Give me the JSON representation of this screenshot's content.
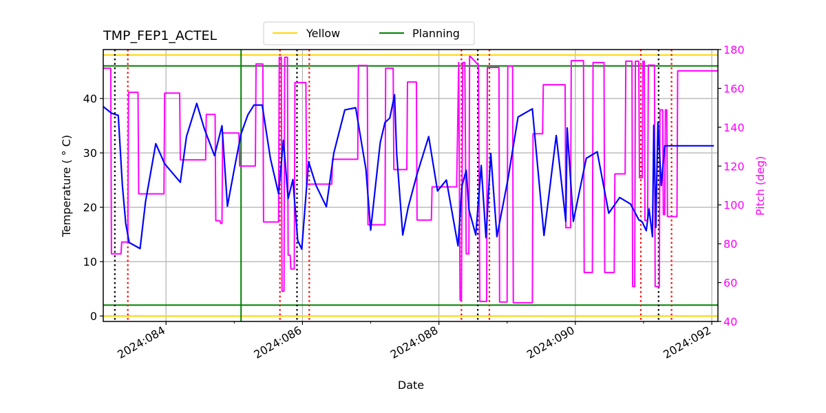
{
  "chart_data": {
    "type": "line",
    "title": "TMP_FEP1_ACTEL",
    "xlabel": "Date",
    "ylabel": "Temperature ($^\\circ$C)",
    "ylabel_display": "Temperature ( ° C)",
    "y2label": "Pitch (deg)",
    "xlim": [
      83.08,
      92.09
    ],
    "ylim": [
      -1,
      49
    ],
    "y2lim": [
      40,
      180
    ],
    "x_ticks": [
      84,
      86,
      88,
      90,
      92
    ],
    "x_tick_labels": [
      "2024:084",
      "2024:086",
      "2024:088",
      "2024:090",
      "2024:092"
    ],
    "x_minor_ticks": [
      85,
      87,
      89,
      91
    ],
    "y_ticks": [
      0,
      10,
      20,
      30,
      40
    ],
    "y_tick_labels": [
      "0",
      "10",
      "20",
      "30",
      "40"
    ],
    "y2_ticks": [
      40,
      60,
      80,
      100,
      120,
      140,
      160,
      180
    ],
    "y2_tick_labels": [
      "40",
      "60",
      "80",
      "100",
      "120",
      "140",
      "160",
      "180"
    ],
    "grid": true,
    "legend": {
      "placement": "top-center-outside",
      "entries": [
        {
          "label": "Yellow",
          "color": "#ffd700"
        },
        {
          "label": "Planning",
          "color": "#008000"
        }
      ]
    },
    "colors": {
      "temperature": "#0000ff",
      "pitch": "#ff00ff",
      "yellow": "#ffd700",
      "planning": "#008000",
      "grid": "#b0b0b0",
      "pitch_axis": "#ff00ff",
      "red_marker": "#ff0000",
      "black_marker": "#000000"
    },
    "limits": {
      "yellow": [
        0,
        48
      ],
      "planning": [
        2,
        46
      ]
    },
    "vertical_markers": {
      "planning": [
        85.1
      ],
      "red_dotted": [
        83.44,
        85.67,
        86.1,
        88.33,
        88.74,
        90.96,
        91.41
      ],
      "black_dotted": [
        83.25,
        85.92,
        88.57,
        91.22
      ]
    },
    "series": [
      {
        "name": "Temperature",
        "axis": "left",
        "x": [
          83.08,
          83.2,
          83.3,
          83.36,
          83.41,
          83.46,
          83.62,
          83.7,
          83.85,
          83.98,
          84.21,
          84.3,
          84.45,
          84.56,
          84.71,
          84.82,
          84.9,
          85.0,
          85.1,
          85.2,
          85.29,
          85.41,
          85.53,
          85.65,
          85.72,
          85.79,
          85.86,
          85.93,
          85.99,
          86.09,
          86.2,
          86.35,
          86.46,
          86.62,
          86.78,
          86.93,
          87.0,
          87.08,
          87.14,
          87.21,
          87.28,
          87.35,
          87.38,
          87.47,
          87.55,
          87.68,
          87.85,
          87.98,
          88.11,
          88.28,
          88.34,
          88.4,
          88.44,
          88.54,
          88.62,
          88.69,
          88.76,
          88.85,
          89.01,
          89.16,
          89.37,
          89.54,
          89.72,
          89.86,
          89.88,
          89.97,
          90.16,
          90.32,
          90.49,
          90.65,
          90.81,
          90.93,
          90.98,
          91.04,
          91.08,
          91.13,
          91.15,
          91.18,
          91.21,
          91.26,
          91.31,
          91.47,
          91.62,
          91.78,
          91.91,
          92.03
        ],
        "y": [
          38.5,
          37.3,
          36.9,
          24.0,
          17.0,
          13.5,
          12.4,
          21.0,
          31.7,
          28.0,
          24.6,
          33.0,
          39.1,
          34.5,
          29.5,
          35.0,
          20.2,
          27.0,
          33.5,
          37.0,
          38.8,
          38.8,
          29.0,
          22.5,
          32.3,
          21.6,
          25.1,
          13.9,
          12.3,
          28.4,
          24.0,
          20.1,
          30.0,
          37.9,
          38.3,
          27.0,
          15.8,
          25.0,
          31.9,
          35.6,
          36.4,
          40.7,
          30.0,
          14.9,
          20.0,
          26.1,
          33.0,
          23.0,
          25.0,
          12.9,
          24.0,
          26.8,
          19.6,
          14.9,
          27.7,
          14.4,
          29.9,
          14.6,
          25.0,
          36.6,
          38.1,
          14.8,
          33.2,
          17.4,
          34.6,
          17.4,
          29.0,
          30.2,
          18.9,
          21.8,
          20.6,
          17.7,
          17.3,
          15.7,
          19.7,
          14.6,
          35.1,
          16.3,
          35.6,
          24.0,
          31.3,
          31.3,
          31.3,
          31.3,
          31.3,
          31.3
        ]
      },
      {
        "name": "Pitch",
        "axis": "right",
        "x": [
          83.08,
          83.19,
          83.2,
          83.34,
          83.35,
          83.44,
          83.45,
          83.59,
          83.6,
          83.97,
          83.98,
          84.2,
          84.21,
          84.58,
          84.59,
          84.72,
          84.73,
          84.79,
          84.8,
          84.82,
          84.83,
          85.07,
          85.08,
          85.31,
          85.32,
          85.42,
          85.43,
          85.65,
          85.66,
          85.69,
          85.7,
          85.73,
          85.74,
          85.78,
          85.79,
          85.82,
          85.83,
          85.88,
          85.89,
          85.95,
          85.96,
          85.97,
          86.05,
          86.06,
          86.43,
          86.44,
          86.81,
          86.82,
          86.95,
          86.96,
          87.21,
          87.22,
          87.33,
          87.34,
          87.53,
          87.54,
          87.67,
          87.68,
          87.89,
          87.9,
          88.26,
          88.29,
          88.31,
          88.33,
          88.35,
          88.38,
          88.4,
          88.44,
          88.45,
          88.46,
          88.58,
          88.6,
          88.67,
          88.7,
          88.71,
          88.72,
          88.88,
          88.89,
          89.0,
          89.01,
          89.08,
          89.09,
          89.16,
          89.17,
          89.37,
          89.38,
          89.52,
          89.53,
          89.85,
          89.86,
          89.93,
          89.94,
          90.12,
          90.13,
          90.25,
          90.26,
          90.42,
          90.43,
          90.57,
          90.58,
          90.73,
          90.74,
          90.83,
          90.84,
          90.87,
          90.88,
          90.93,
          90.94,
          90.98,
          90.99,
          91.01,
          91.02,
          91.06,
          91.07,
          91.16,
          91.17,
          91.23,
          91.24,
          91.28,
          91.29,
          91.31,
          91.32,
          91.34,
          91.35,
          91.49,
          91.5,
          91.7,
          91.71,
          91.85,
          91.86,
          91.97,
          91.98,
          92.09
        ],
        "y": [
          170.4,
          170.4,
          74.8,
          74.8,
          80.9,
          80.9,
          158.0,
          158.0,
          105.7,
          105.7,
          157.6,
          157.6,
          123.2,
          123.2,
          146.6,
          146.6,
          91.9,
          91.9,
          90.5,
          90.5,
          137.0,
          137.0,
          120.0,
          120.0,
          172.6,
          172.6,
          91.2,
          91.2,
          176.0,
          176.0,
          55.6,
          55.6,
          176.0,
          176.0,
          74.1,
          74.1,
          67.0,
          67.0,
          163.0,
          163.0,
          163.0,
          163.0,
          163.0,
          110.7,
          110.7,
          123.5,
          123.5,
          171.8,
          171.8,
          89.8,
          89.8,
          170.4,
          170.4,
          118.2,
          118.2,
          163.3,
          163.3,
          92.2,
          92.2,
          109.3,
          109.3,
          173.3,
          51.0,
          51.0,
          173.3,
          173.3,
          74.8,
          74.8,
          176.5,
          176.5,
          172.0,
          50.3,
          50.3,
          50.3,
          170.8,
          170.8,
          170.8,
          50.0,
          50.0,
          171.5,
          171.5,
          49.6,
          49.6,
          49.6,
          49.6,
          136.7,
          136.7,
          161.9,
          161.9,
          88.3,
          88.3,
          174.3,
          174.3,
          65.2,
          65.2,
          173.3,
          173.3,
          65.2,
          65.2,
          116.0,
          116.0,
          174.0,
          174.0,
          58.0,
          58.0,
          174.0,
          174.0,
          114.0,
          114.0,
          174.0,
          174.0,
          92.0,
          92.0,
          172.0,
          172.0,
          58.0,
          58.0,
          149.0,
          149.0,
          95.0,
          95.0,
          149.0,
          149.0,
          94.0,
          94.0,
          169.0,
          169.0,
          169.0,
          169.0,
          169.0,
          169.0,
          169.0,
          169.0
        ]
      }
    ]
  }
}
